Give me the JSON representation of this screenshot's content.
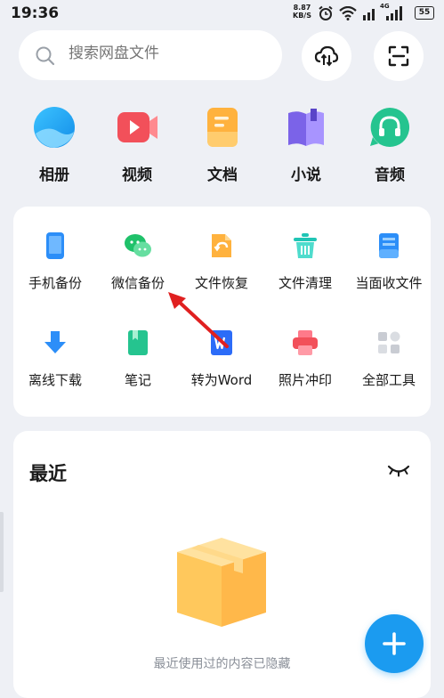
{
  "status_bar": {
    "time": "19:36",
    "net_speed_value": "8.87",
    "net_speed_unit": "KB/S",
    "network_type": "4G",
    "battery": "55"
  },
  "search": {
    "placeholder": "搜索网盘文件"
  },
  "categories": [
    {
      "label": "相册",
      "icon": "album-icon"
    },
    {
      "label": "视频",
      "icon": "video-icon"
    },
    {
      "label": "文档",
      "icon": "document-icon"
    },
    {
      "label": "小说",
      "icon": "novel-icon"
    },
    {
      "label": "音频",
      "icon": "audio-icon"
    }
  ],
  "tools": [
    {
      "label": "手机备份",
      "icon": "phone-backup-icon"
    },
    {
      "label": "微信备份",
      "icon": "wechat-backup-icon"
    },
    {
      "label": "文件恢复",
      "icon": "file-recovery-icon"
    },
    {
      "label": "文件清理",
      "icon": "file-cleanup-icon"
    },
    {
      "label": "当面收文件",
      "icon": "receive-file-icon"
    },
    {
      "label": "离线下载",
      "icon": "offline-download-icon"
    },
    {
      "label": "笔记",
      "icon": "notes-icon"
    },
    {
      "label": "转为Word",
      "icon": "convert-word-icon"
    },
    {
      "label": "照片冲印",
      "icon": "photo-print-icon"
    },
    {
      "label": "全部工具",
      "icon": "all-tools-icon"
    }
  ],
  "recent": {
    "title": "最近",
    "empty_text": "最近使用过的内容已隐藏"
  },
  "colors": {
    "accent": "#1b9bf0",
    "annotation_arrow": "#e02020"
  }
}
